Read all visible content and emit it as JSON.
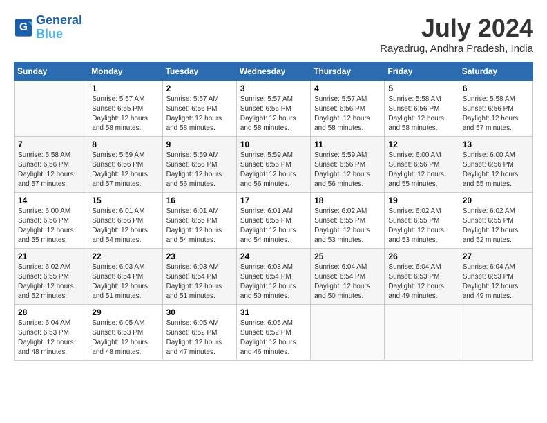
{
  "header": {
    "logo_line1": "General",
    "logo_line2": "Blue",
    "title": "July 2024",
    "location": "Rayadrug, Andhra Pradesh, India"
  },
  "weekdays": [
    "Sunday",
    "Monday",
    "Tuesday",
    "Wednesday",
    "Thursday",
    "Friday",
    "Saturday"
  ],
  "weeks": [
    [
      {
        "day": "",
        "info": ""
      },
      {
        "day": "1",
        "info": "Sunrise: 5:57 AM\nSunset: 6:55 PM\nDaylight: 12 hours\nand 58 minutes."
      },
      {
        "day": "2",
        "info": "Sunrise: 5:57 AM\nSunset: 6:56 PM\nDaylight: 12 hours\nand 58 minutes."
      },
      {
        "day": "3",
        "info": "Sunrise: 5:57 AM\nSunset: 6:56 PM\nDaylight: 12 hours\nand 58 minutes."
      },
      {
        "day": "4",
        "info": "Sunrise: 5:57 AM\nSunset: 6:56 PM\nDaylight: 12 hours\nand 58 minutes."
      },
      {
        "day": "5",
        "info": "Sunrise: 5:58 AM\nSunset: 6:56 PM\nDaylight: 12 hours\nand 58 minutes."
      },
      {
        "day": "6",
        "info": "Sunrise: 5:58 AM\nSunset: 6:56 PM\nDaylight: 12 hours\nand 57 minutes."
      }
    ],
    [
      {
        "day": "7",
        "info": "Sunrise: 5:58 AM\nSunset: 6:56 PM\nDaylight: 12 hours\nand 57 minutes."
      },
      {
        "day": "8",
        "info": "Sunrise: 5:59 AM\nSunset: 6:56 PM\nDaylight: 12 hours\nand 57 minutes."
      },
      {
        "day": "9",
        "info": "Sunrise: 5:59 AM\nSunset: 6:56 PM\nDaylight: 12 hours\nand 56 minutes."
      },
      {
        "day": "10",
        "info": "Sunrise: 5:59 AM\nSunset: 6:56 PM\nDaylight: 12 hours\nand 56 minutes."
      },
      {
        "day": "11",
        "info": "Sunrise: 5:59 AM\nSunset: 6:56 PM\nDaylight: 12 hours\nand 56 minutes."
      },
      {
        "day": "12",
        "info": "Sunrise: 6:00 AM\nSunset: 6:56 PM\nDaylight: 12 hours\nand 55 minutes."
      },
      {
        "day": "13",
        "info": "Sunrise: 6:00 AM\nSunset: 6:56 PM\nDaylight: 12 hours\nand 55 minutes."
      }
    ],
    [
      {
        "day": "14",
        "info": "Sunrise: 6:00 AM\nSunset: 6:56 PM\nDaylight: 12 hours\nand 55 minutes."
      },
      {
        "day": "15",
        "info": "Sunrise: 6:01 AM\nSunset: 6:56 PM\nDaylight: 12 hours\nand 54 minutes."
      },
      {
        "day": "16",
        "info": "Sunrise: 6:01 AM\nSunset: 6:55 PM\nDaylight: 12 hours\nand 54 minutes."
      },
      {
        "day": "17",
        "info": "Sunrise: 6:01 AM\nSunset: 6:55 PM\nDaylight: 12 hours\nand 54 minutes."
      },
      {
        "day": "18",
        "info": "Sunrise: 6:02 AM\nSunset: 6:55 PM\nDaylight: 12 hours\nand 53 minutes."
      },
      {
        "day": "19",
        "info": "Sunrise: 6:02 AM\nSunset: 6:55 PM\nDaylight: 12 hours\nand 53 minutes."
      },
      {
        "day": "20",
        "info": "Sunrise: 6:02 AM\nSunset: 6:55 PM\nDaylight: 12 hours\nand 52 minutes."
      }
    ],
    [
      {
        "day": "21",
        "info": "Sunrise: 6:02 AM\nSunset: 6:55 PM\nDaylight: 12 hours\nand 52 minutes."
      },
      {
        "day": "22",
        "info": "Sunrise: 6:03 AM\nSunset: 6:54 PM\nDaylight: 12 hours\nand 51 minutes."
      },
      {
        "day": "23",
        "info": "Sunrise: 6:03 AM\nSunset: 6:54 PM\nDaylight: 12 hours\nand 51 minutes."
      },
      {
        "day": "24",
        "info": "Sunrise: 6:03 AM\nSunset: 6:54 PM\nDaylight: 12 hours\nand 50 minutes."
      },
      {
        "day": "25",
        "info": "Sunrise: 6:04 AM\nSunset: 6:54 PM\nDaylight: 12 hours\nand 50 minutes."
      },
      {
        "day": "26",
        "info": "Sunrise: 6:04 AM\nSunset: 6:53 PM\nDaylight: 12 hours\nand 49 minutes."
      },
      {
        "day": "27",
        "info": "Sunrise: 6:04 AM\nSunset: 6:53 PM\nDaylight: 12 hours\nand 49 minutes."
      }
    ],
    [
      {
        "day": "28",
        "info": "Sunrise: 6:04 AM\nSunset: 6:53 PM\nDaylight: 12 hours\nand 48 minutes."
      },
      {
        "day": "29",
        "info": "Sunrise: 6:05 AM\nSunset: 6:53 PM\nDaylight: 12 hours\nand 48 minutes."
      },
      {
        "day": "30",
        "info": "Sunrise: 6:05 AM\nSunset: 6:52 PM\nDaylight: 12 hours\nand 47 minutes."
      },
      {
        "day": "31",
        "info": "Sunrise: 6:05 AM\nSunset: 6:52 PM\nDaylight: 12 hours\nand 46 minutes."
      },
      {
        "day": "",
        "info": ""
      },
      {
        "day": "",
        "info": ""
      },
      {
        "day": "",
        "info": ""
      }
    ]
  ]
}
